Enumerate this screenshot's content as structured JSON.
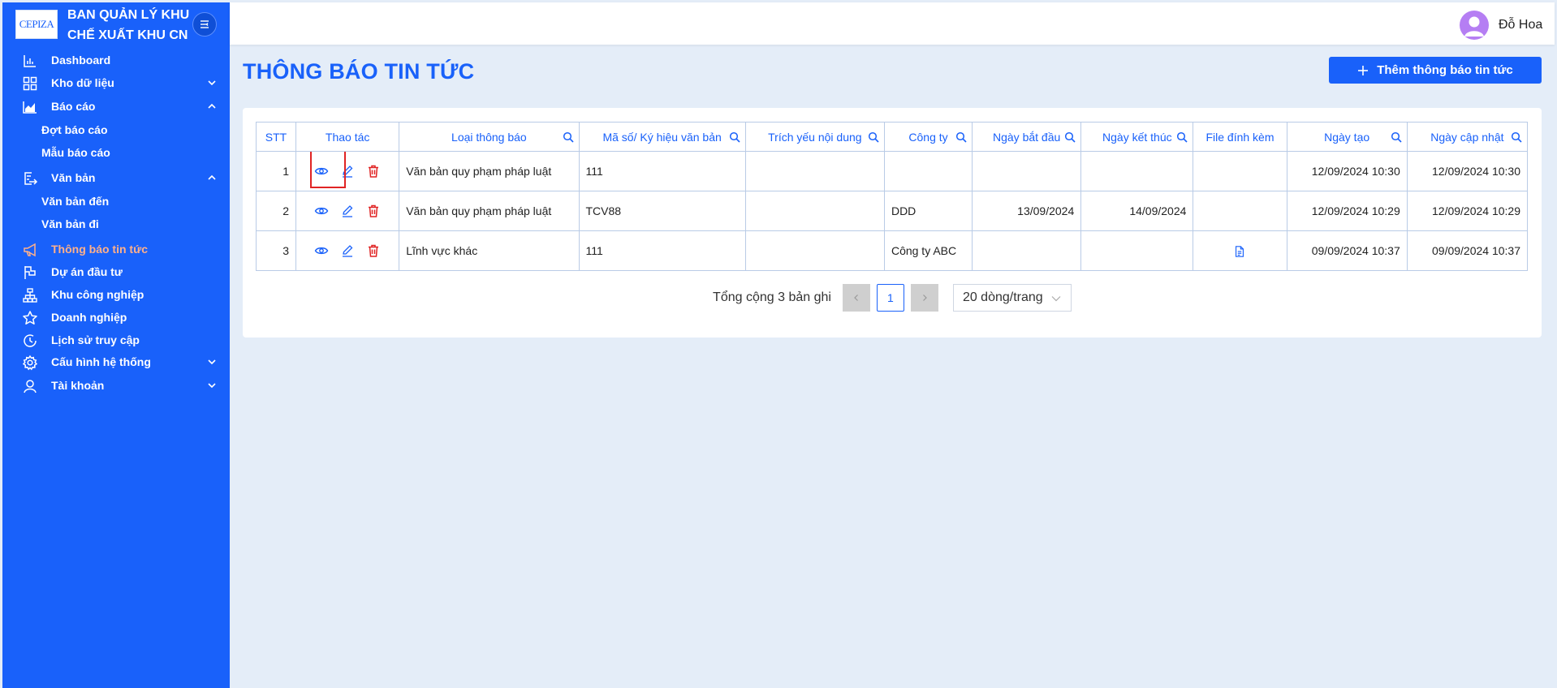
{
  "brand": {
    "logo_text": "CEPIZA",
    "line1": "BAN QUẢN LÝ KHU",
    "line2": "CHẾ XUẤT KHU CN"
  },
  "sidebar": {
    "items": [
      {
        "label": "Dashboard",
        "icon": "bar-chart-icon"
      },
      {
        "label": "Kho dữ liệu",
        "icon": "grid-icon",
        "chevron": "down"
      },
      {
        "label": "Báo cáo",
        "icon": "area-chart-icon",
        "chevron": "up"
      },
      {
        "label": "Đợt báo cáo",
        "sub": true
      },
      {
        "label": "Mẫu báo cáo",
        "sub": true
      },
      {
        "label": "Văn bản",
        "icon": "document-send-icon",
        "chevron": "up"
      },
      {
        "label": "Văn bản đến",
        "sub": true
      },
      {
        "label": "Văn bản đi",
        "sub": true
      },
      {
        "label": "Thông báo tin tức",
        "icon": "megaphone-icon",
        "active": true
      },
      {
        "label": "Dự án đầu tư",
        "icon": "flag-icon"
      },
      {
        "label": "Khu công nghiệp",
        "icon": "cluster-icon"
      },
      {
        "label": "Doanh nghiệp",
        "icon": "star-icon"
      },
      {
        "label": "Lịch sử truy cập",
        "icon": "clock-icon"
      },
      {
        "label": "Cấu hình hệ thống",
        "icon": "gear-icon",
        "chevron": "down"
      },
      {
        "label": "Tài khoản",
        "icon": "user-icon",
        "chevron": "down"
      }
    ]
  },
  "header": {
    "user_name": "Đỗ Hoa"
  },
  "page": {
    "title": "THÔNG BÁO TIN TỨC",
    "add_button": "Thêm thông báo tin tức"
  },
  "table": {
    "columns": [
      {
        "label": "STT",
        "search": false
      },
      {
        "label": "Thao tác",
        "search": false
      },
      {
        "label": "Loại thông báo",
        "search": true
      },
      {
        "label": "Mã số/ Ký hiệu văn bản",
        "search": true
      },
      {
        "label": "Trích yếu nội dung",
        "search": true
      },
      {
        "label": "Công ty",
        "search": true
      },
      {
        "label": "Ngày bắt đầu",
        "search": true
      },
      {
        "label": "Ngày kết thúc",
        "search": true
      },
      {
        "label": "File đính kèm",
        "search": false
      },
      {
        "label": "Ngày tạo",
        "search": true
      },
      {
        "label": "Ngày cập nhật",
        "search": true
      }
    ],
    "rows": [
      {
        "stt": "1",
        "type": "Văn bản quy phạm pháp luật",
        "code": "111",
        "summary": "",
        "company": "",
        "start": "",
        "end": "",
        "file": false,
        "created": "12/09/2024 10:30",
        "updated": "12/09/2024 10:30"
      },
      {
        "stt": "2",
        "type": "Văn bản quy phạm pháp luật",
        "code": "TCV88",
        "summary": "",
        "company": "DDD",
        "start": "13/09/2024",
        "end": "14/09/2024",
        "file": false,
        "created": "12/09/2024 10:29",
        "updated": "12/09/2024 10:29"
      },
      {
        "stt": "3",
        "type": "Lĩnh vực khác",
        "code": "111",
        "summary": "",
        "company": "Công ty ABC",
        "start": "",
        "end": "",
        "file": true,
        "created": "09/09/2024 10:37",
        "updated": "09/09/2024 10:37"
      }
    ]
  },
  "pagination": {
    "total": "Tổng cộng 3 bản ghi",
    "current_page": "1",
    "page_size": "20 dòng/trang"
  },
  "colors": {
    "primary": "#1961fa",
    "active_menu": "#ffb08a",
    "delete": "#e02424",
    "background": "#e4edf8"
  }
}
